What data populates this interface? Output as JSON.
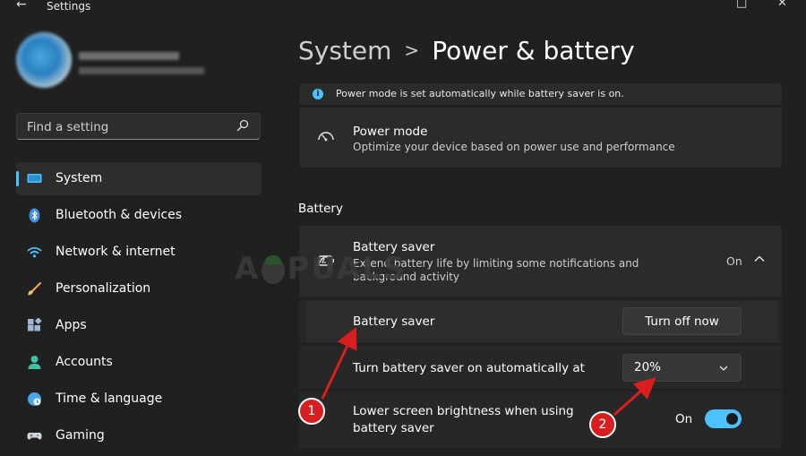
{
  "window": {
    "title": "Settings"
  },
  "search": {
    "placeholder": "Find a setting"
  },
  "nav": [
    {
      "label": "System",
      "icon": "monitor-icon",
      "active": true
    },
    {
      "label": "Bluetooth & devices",
      "icon": "bluetooth-icon"
    },
    {
      "label": "Network & internet",
      "icon": "wifi-icon"
    },
    {
      "label": "Personalization",
      "icon": "brush-icon"
    },
    {
      "label": "Apps",
      "icon": "apps-icon"
    },
    {
      "label": "Accounts",
      "icon": "person-icon"
    },
    {
      "label": "Time & language",
      "icon": "globe-clock-icon"
    },
    {
      "label": "Gaming",
      "icon": "gamepad-icon"
    }
  ],
  "breadcrumb": {
    "parent": "System",
    "separator": ">",
    "current": "Power & battery"
  },
  "info": {
    "text": "Power mode is set automatically while battery saver is on."
  },
  "power_mode": {
    "title": "Power mode",
    "description": "Optimize your device based on power use and performance"
  },
  "battery_section": {
    "title": "Battery"
  },
  "battery_saver": {
    "title": "Battery saver",
    "description": "Extend battery life by limiting some notifications and background activity",
    "state": "On",
    "row_label": "Battery saver",
    "button_label": "Turn off now",
    "auto_label": "Turn battery saver on automatically at",
    "auto_value": "20%",
    "brightness_label": "Lower screen brightness when using battery saver",
    "brightness_state": "On",
    "brightness_on": true
  },
  "watermark": {
    "text_left": "A",
    "text_right": "PUALS"
  },
  "annotations": {
    "one": "1",
    "two": "2"
  },
  "colors": {
    "accent": "#4cc2ff",
    "background": "#202020",
    "card": "#2b2b2b",
    "annotation": "#d81e1e"
  }
}
